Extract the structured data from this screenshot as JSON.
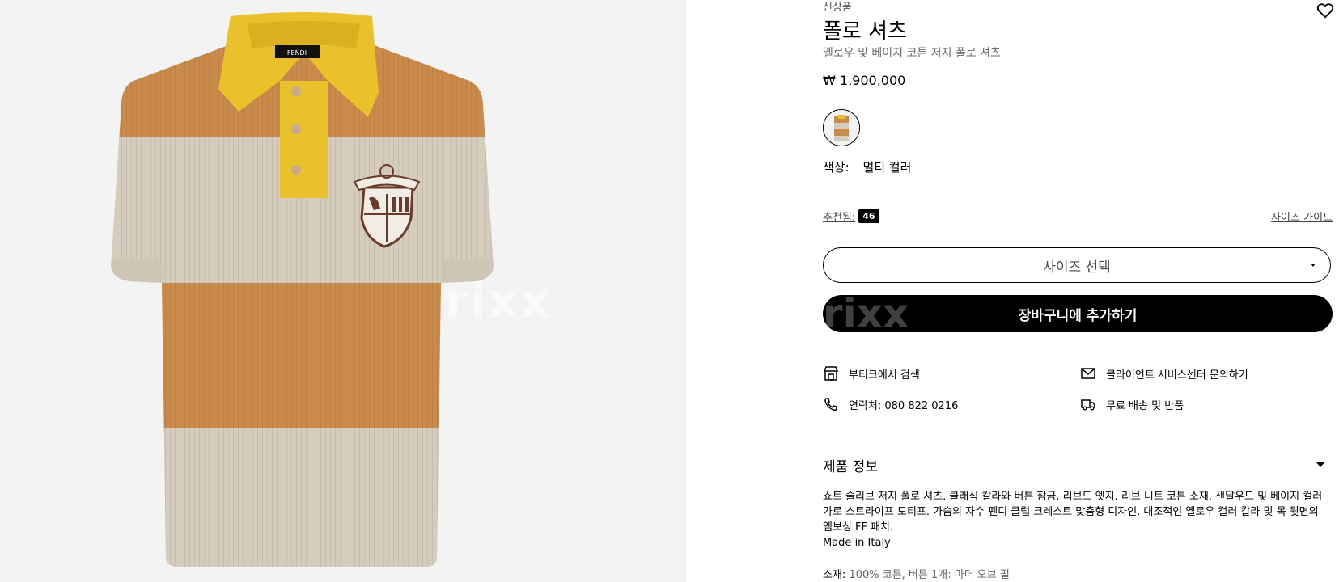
{
  "watermark": "rixx",
  "product": {
    "eyebrow": "신상품",
    "title": "폴로 셔츠",
    "subtitle": "옐로우 및 베이지 코튼 저지 폴로 셔츠",
    "price": "₩ 1,900,000",
    "color_label": "색상:",
    "color_value": "멀티 컬러",
    "recommended_label": "추천됨:",
    "recommended_size": "46",
    "size_guide": "사이즈 가이드",
    "size_select_placeholder": "사이즈 선택",
    "add_to_cart": "장바구니에 추가하기",
    "product_logo_text": "FENDI"
  },
  "services": [
    {
      "icon": "store-icon",
      "label": "부티크에서 검색"
    },
    {
      "icon": "mail-icon",
      "label": "클라이언트 서비스센터 문의하기"
    },
    {
      "icon": "phone-icon",
      "label": "연락처: 080 822 0216"
    },
    {
      "icon": "truck-icon",
      "label": "무료 배송 및 반품"
    }
  ],
  "details": {
    "title": "제품 정보",
    "description": "쇼트 슬리브 저지 폴로 셔츠. 클래식 칼라와 버튼 잠금. 리브드 엣지. 리브 니트 코튼 소재. 샌달우드 및 베이지 컬러 가로 스트라이프 모티프. 가슴의 자수 펜디 클럽 크레스트 맞춤형 디자인. 대조적인 옐로우 컬러 칼라 및 목 뒷면의 엠보싱 FF 패치.",
    "made_in": "Made in Italy",
    "material_label": "소재:",
    "material_value": "100% 코튼, 버튼 1개: 마더 오브 펄"
  },
  "colors": {
    "orange_stripe": "#c98a4a",
    "beige_stripe": "#d6ccbc",
    "collar_yellow": "#e9c12b",
    "gallery_bg": "#f3f3f3"
  }
}
